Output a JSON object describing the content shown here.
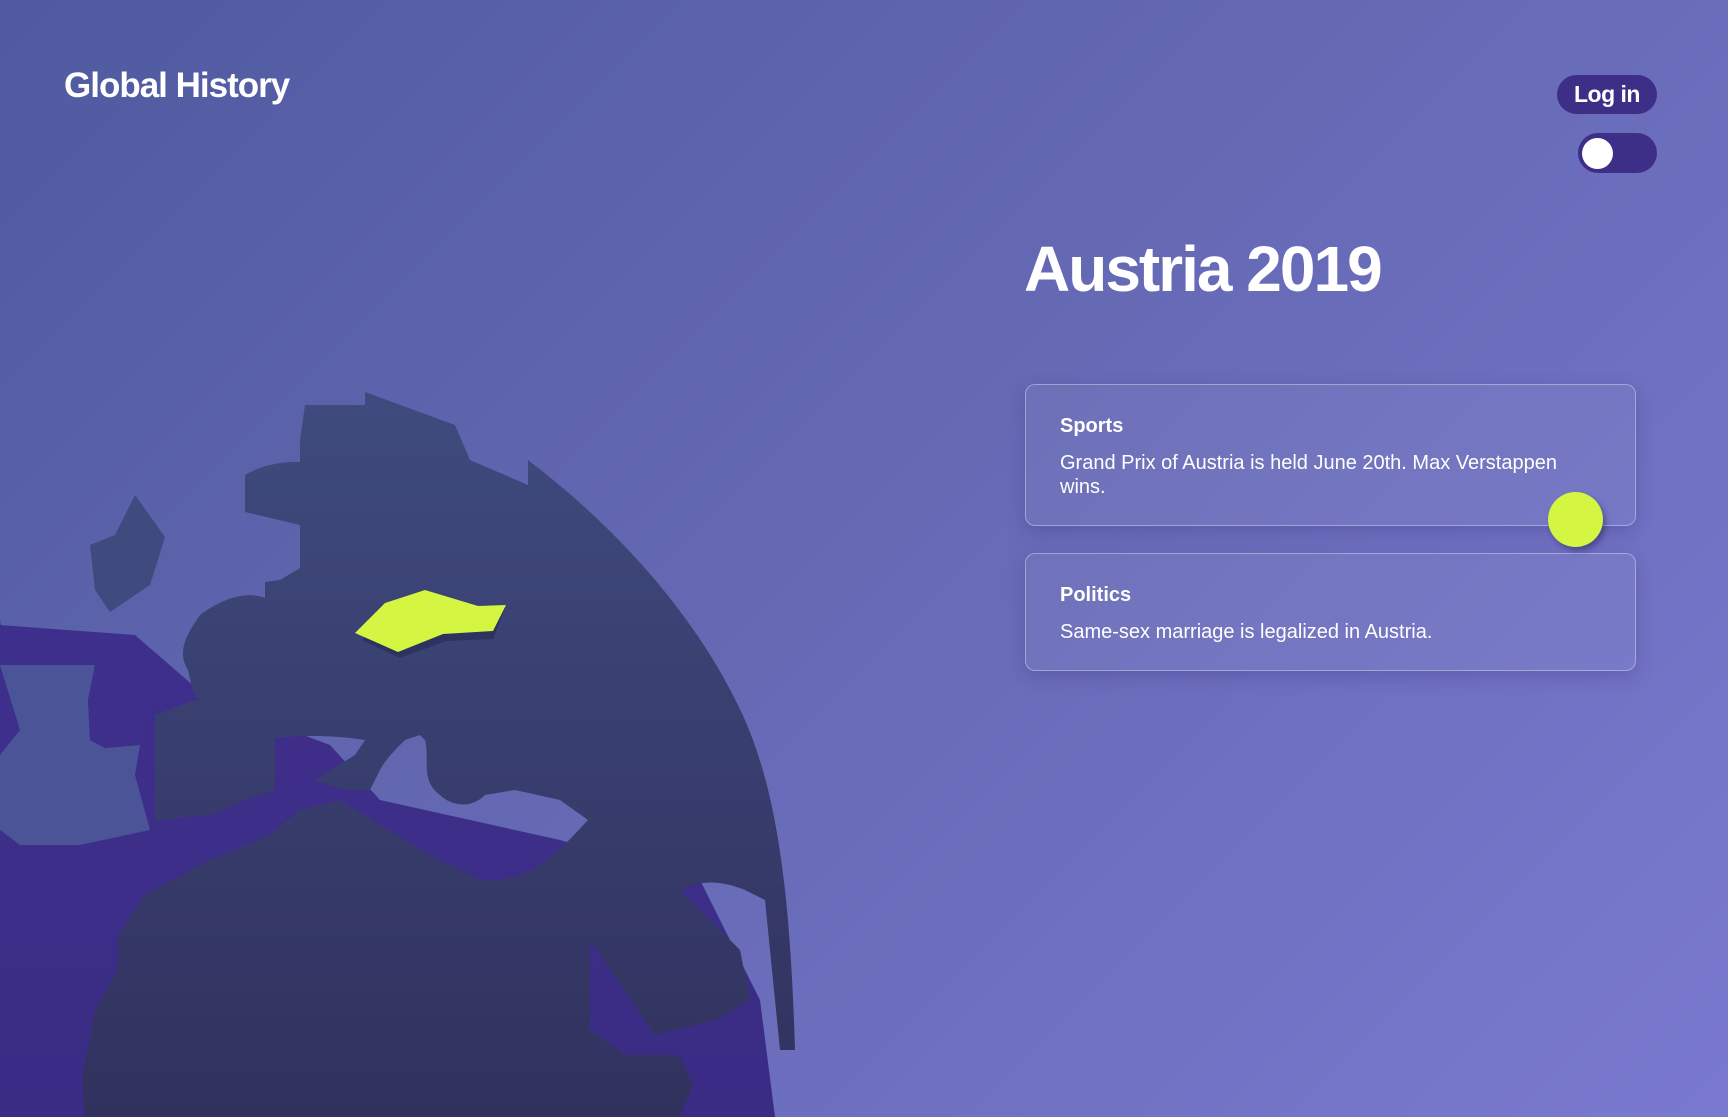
{
  "header": {
    "logo": "Global History",
    "login_label": "Log in",
    "theme_toggle_state": "off"
  },
  "main": {
    "title": "Austria 2019",
    "events": [
      {
        "category": "Sports",
        "text": "Grand Prix of Austria is held June 20th. Max Verstappen wins."
      },
      {
        "category": "Politics",
        "text": "Same-sex marriage is legalized in Austria."
      }
    ]
  },
  "map": {
    "highlighted_country_icon": "austria-highlight-shape",
    "globe_icon": "europe-globe-map"
  },
  "colors": {
    "background_start": "#4f5aa0",
    "background_end": "#7a79d0",
    "accent": "#d4f542",
    "button": "#3d2f87",
    "land_dark": "#3c4474",
    "sea_dark": "#3e2f8a",
    "text": "#ffffff"
  }
}
